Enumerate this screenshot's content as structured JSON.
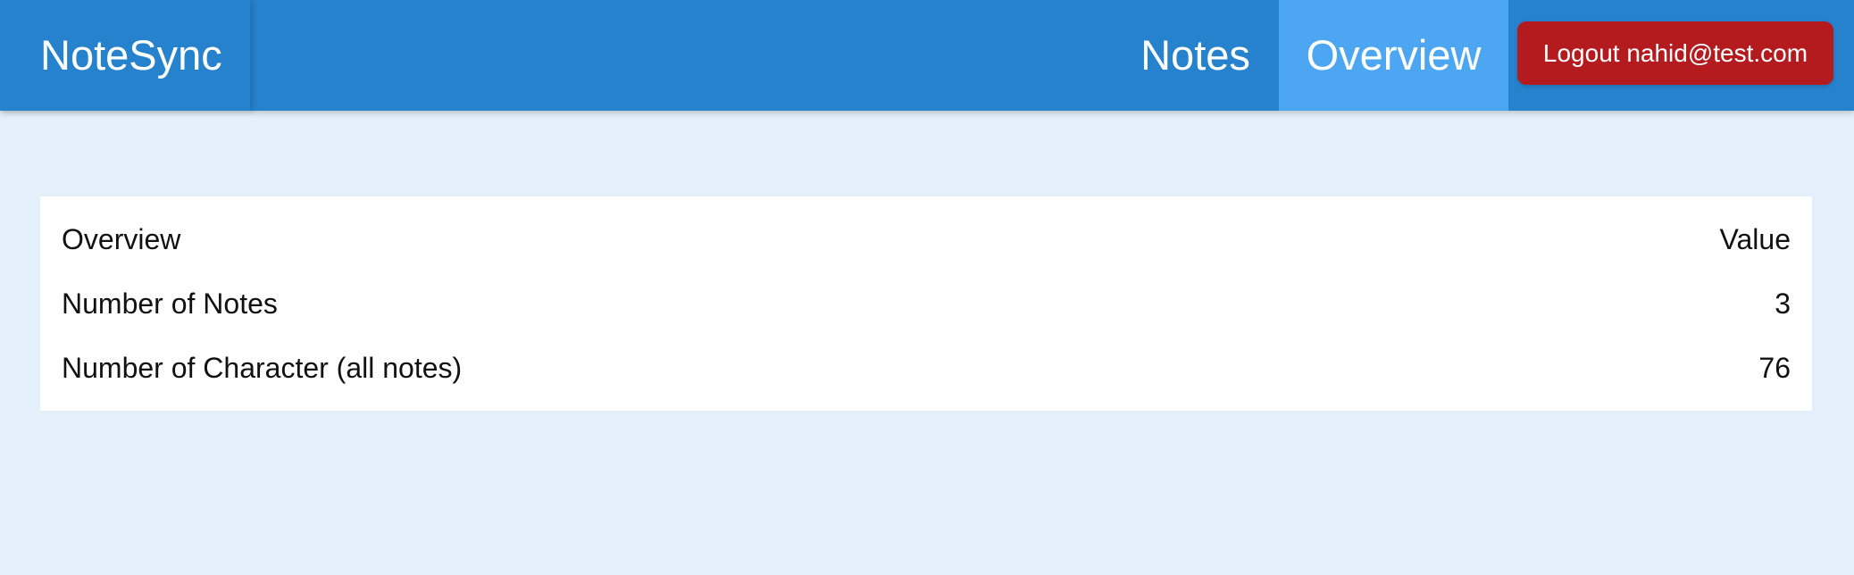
{
  "navbar": {
    "brand": "NoteSync",
    "links": [
      {
        "label": "Notes",
        "active": false
      },
      {
        "label": "Overview",
        "active": true
      }
    ],
    "logout_label": "Logout nahid@test.com"
  },
  "table": {
    "headers": [
      "Overview",
      "Value"
    ],
    "rows": [
      {
        "label": "Number of Notes",
        "value": "3"
      },
      {
        "label": "Number of Character (all notes)",
        "value": "76"
      }
    ]
  },
  "colors": {
    "navbar": "#2782cd",
    "active_tab": "#4ca6f2",
    "logout_button": "#b31b1f",
    "page_background": "#e3f0fb"
  }
}
